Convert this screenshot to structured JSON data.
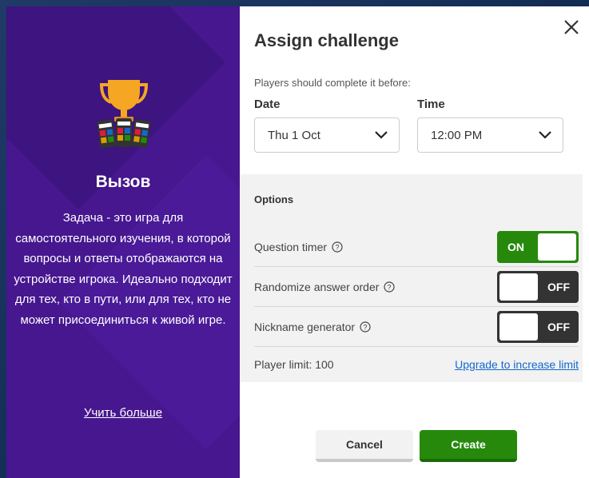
{
  "promo": {
    "title": "Вызов",
    "description": "Задача - это игра для самостоятельного изучения, в которой вопросы и ответы отображаются на устройстве игрока. Идеально подходит для тех, кто в пути, или для тех, кто не может присоединиться к живой игре.",
    "learn_more": "Учить больше",
    "illustration": "trophy-with-phones-icon"
  },
  "dialog": {
    "title": "Assign challenge",
    "close_icon": "close-icon",
    "subtitle": "Players should complete it before:",
    "date": {
      "label": "Date",
      "value": "Thu 1 Oct"
    },
    "time": {
      "label": "Time",
      "value": "12:00 PM"
    }
  },
  "options": {
    "title": "Options",
    "rows": [
      {
        "label": "Question timer",
        "state": "ON"
      },
      {
        "label": "Randomize answer order",
        "state": "OFF"
      },
      {
        "label": "Nickname generator",
        "state": "OFF"
      }
    ],
    "player_limit": "Player limit: 100",
    "upgrade_link": "Upgrade to increase limit"
  },
  "buttons": {
    "cancel": "Cancel",
    "create": "Create"
  },
  "colors": {
    "purple": "#46178f",
    "green": "#26890c",
    "dark": "#333333",
    "link": "#1368ce"
  }
}
